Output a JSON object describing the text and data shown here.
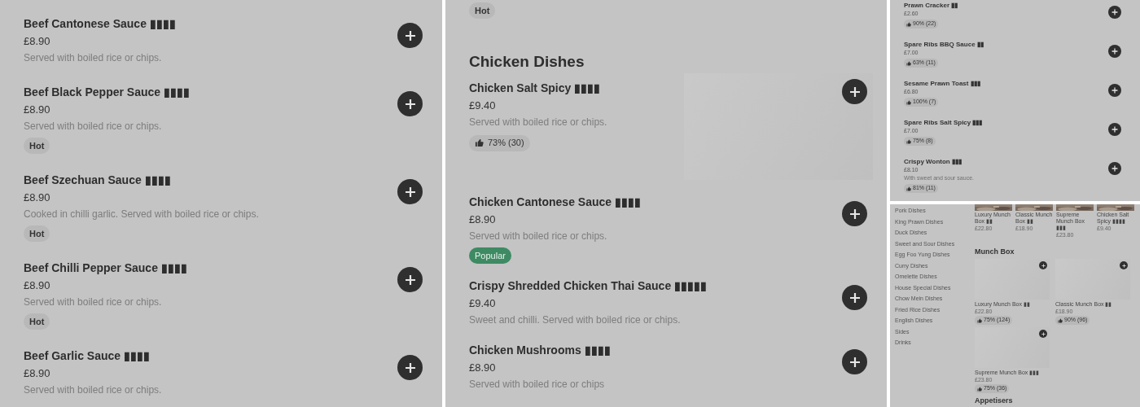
{
  "left_panel": {
    "items": [
      {
        "name": "Beef Cantonese Sauce ▮▮▮▮",
        "price": "£8.90",
        "description": "Served with boiled rice or chips."
      },
      {
        "name": "Beef Black Pepper Sauce ▮▮▮▮",
        "price": "£8.90",
        "description": "Served with boiled rice or chips.",
        "tags": [
          {
            "label": "Hot",
            "kind": "plain"
          }
        ]
      },
      {
        "name": "Beef Szechuan Sauce ▮▮▮▮",
        "price": "£8.90",
        "description": "Cooked in chilli garlic. Served with boiled rice or chips.",
        "tags": [
          {
            "label": "Hot",
            "kind": "plain"
          }
        ]
      },
      {
        "name": "Beef Chilli Pepper Sauce ▮▮▮▮",
        "price": "£8.90",
        "description": "Served with boiled rice or chips.",
        "tags": [
          {
            "label": "Hot",
            "kind": "plain"
          }
        ]
      },
      {
        "name": "Beef Garlic Sauce ▮▮▮▮",
        "price": "£8.90",
        "description": "Served with boiled rice or chips."
      }
    ]
  },
  "middle_panel": {
    "leading_tags": [
      {
        "label": "Hot",
        "kind": "plain"
      }
    ],
    "section": "Chicken Dishes",
    "items": [
      {
        "name": "Chicken Salt Spicy ▮▮▮▮",
        "price": "£9.40",
        "description": "Served with boiled rice or chips.",
        "rating": "73% (30)",
        "image": true
      },
      {
        "name": "Chicken Cantonese Sauce ▮▮▮▮",
        "price": "£8.90",
        "description": "Served with boiled rice or chips.",
        "tags": [
          {
            "label": "Popular",
            "kind": "popular"
          }
        ]
      },
      {
        "name": "Crispy Shredded Chicken Thai Sauce ▮▮▮▮▮",
        "price": "£9.40",
        "description": "Sweet and chilli. Served with boiled rice or chips."
      },
      {
        "name": "Chicken Mushrooms ▮▮▮▮",
        "price": "£8.90",
        "description": "Served with boiled rice or chips"
      }
    ]
  },
  "right_top_panel": {
    "items": [
      {
        "name": "Prawn Cracker ▮▮",
        "price": "£2.60",
        "rating": "90% (22)"
      },
      {
        "name": "Spare Ribs BBQ Sauce ▮▮",
        "price": "£7.00",
        "rating": "63% (11)"
      },
      {
        "name": "Sesame Prawn Toast ▮▮▮",
        "price": "£6.80",
        "rating": "100% (7)"
      },
      {
        "name": "Spare Ribs Salt Spicy ▮▮▮",
        "price": "£7.00",
        "rating": "75% (8)"
      },
      {
        "name": "Crispy Wonton ▮▮▮",
        "price": "£8.10",
        "description": "With sweet and sour sauce.",
        "rating": "81% (11)"
      }
    ]
  },
  "right_bottom_panel": {
    "categories": [
      "Pork Dishes",
      "King Prawn Dishes",
      "Duck Dishes",
      "Sweet and Sour Dishes",
      "Egg Foo Yung Dishes",
      "Curry Dishes",
      "Omelette Dishes",
      "House Special Dishes",
      "Chow Mein Dishes",
      "Fried Rice Dishes",
      "English Dishes",
      "Sides",
      "Drinks"
    ],
    "carousel": [
      {
        "name": "Luxury Munch Box ▮▮",
        "price": "£22.80"
      },
      {
        "name": "Classic Munch Box ▮▮",
        "price": "£18.90"
      },
      {
        "name": "Supreme Munch Box ▮▮▮",
        "price": "£23.80"
      },
      {
        "name": "Chicken Salt Spicy ▮▮▮▮",
        "price": "£9.40"
      }
    ],
    "section": "Munch Box",
    "cards": [
      {
        "name": "Luxury Munch Box ▮▮",
        "price": "£22.80",
        "rating": "75% (124)"
      },
      {
        "name": "Classic Munch Box ▮▮",
        "price": "£18.90",
        "rating": "90% (96)"
      },
      {
        "name": "Supreme Munch Box ▮▮▮",
        "price": "£23.80",
        "rating": "75% (36)"
      }
    ],
    "next_section": "Appetisers"
  }
}
